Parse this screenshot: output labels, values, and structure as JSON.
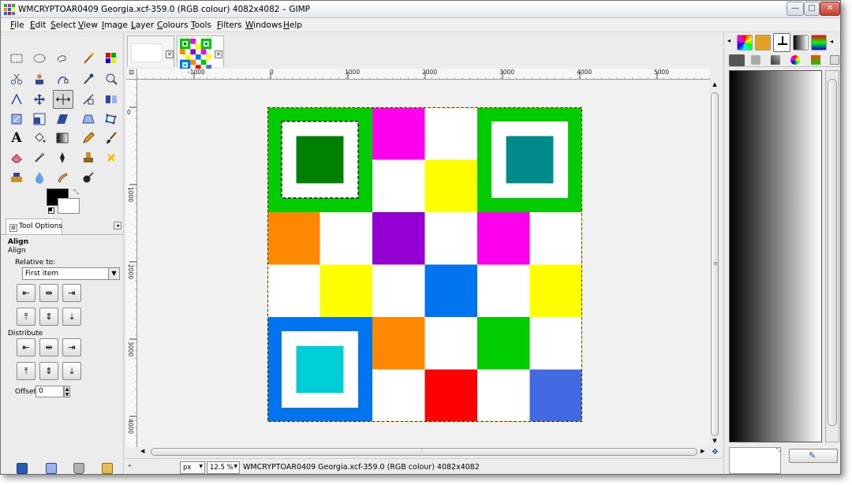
{
  "window": {
    "title": "WMCRYPTOAR0409 Georgia.xcf-359.0 (RGB colour) 4082x4082 – GIMP",
    "minimize_label": "—",
    "maximize_label": "□",
    "close_label": "✕"
  },
  "menu": [
    "File",
    "Edit",
    "Select",
    "View",
    "Image",
    "Layer",
    "Colours",
    "Tools",
    "Filters",
    "Windows",
    "Help"
  ],
  "tool_options": {
    "tab_label": "Tool Options",
    "heading": "Align",
    "subheading": "Align",
    "relative_label": "Relative to:",
    "relative_value": "First item",
    "distribute_label": "Distribute",
    "offset_label": "Offset:",
    "offset_value": "0"
  },
  "ruler": {
    "top_labels": [
      "-1000",
      "0",
      "1000",
      "2000",
      "3000",
      "4000",
      "5000"
    ],
    "left_labels": [
      "0",
      "1000",
      "2000",
      "3000",
      "4000"
    ]
  },
  "statusbar": {
    "unit": "px",
    "zoom": "12.5 %",
    "text": "WMCRYPTOAR0409 Georgia.xcf-359.0 (RGB colour) 4082x4082"
  },
  "colors": {
    "green_frame": "#00cc00",
    "green_inner": "#008000",
    "teal_inner": "#008b8b",
    "blue_frame": "#0074ee",
    "cyan_inner": "#00ced6",
    "magenta": "#ff00ee",
    "yellow": "#ffff00",
    "orange": "#ff8800",
    "purple": "#9400d3",
    "blue": "#0074ee",
    "red": "#ff0000",
    "green": "#00cc00",
    "royal_blue": "#4169e1"
  }
}
